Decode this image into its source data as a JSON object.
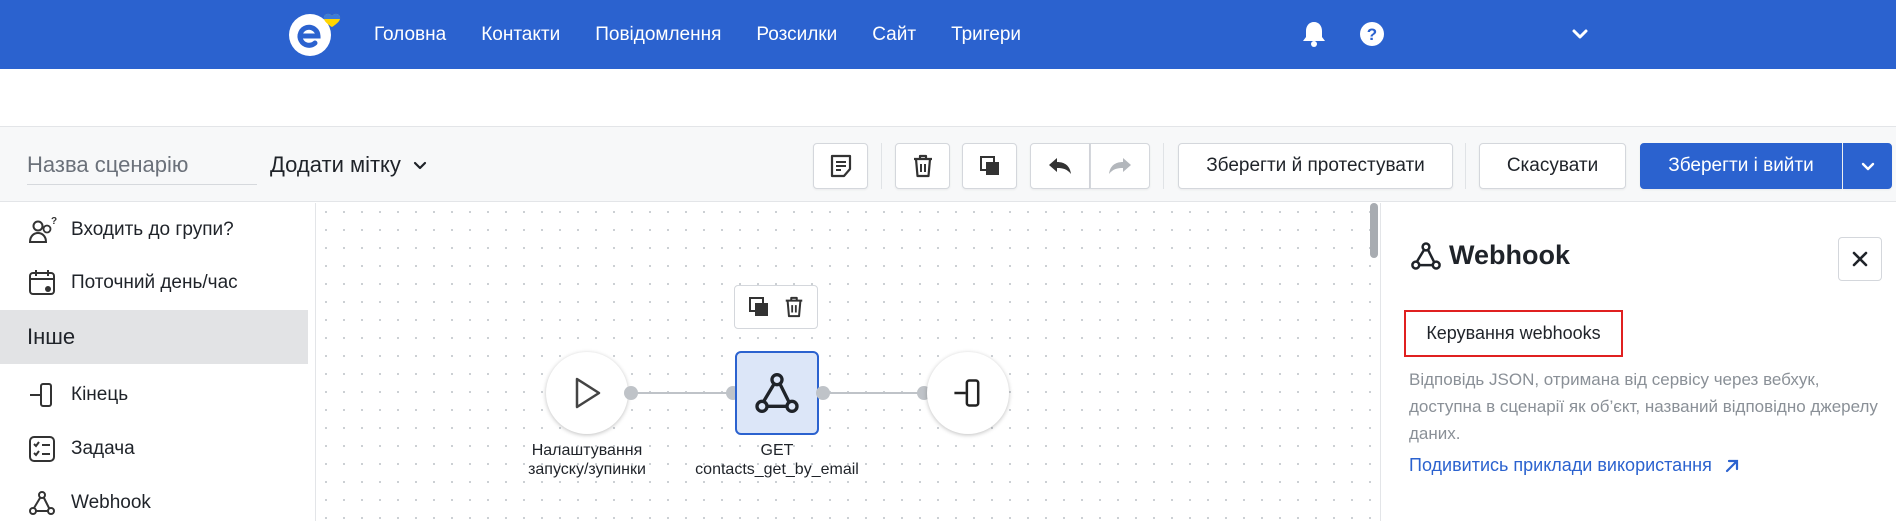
{
  "nav": {
    "items": [
      "Головна",
      "Контакти",
      "Повідомлення",
      "Розсилки",
      "Сайт",
      "Тригери"
    ]
  },
  "icons": {
    "logo": "esputnik-logo-icon",
    "bell": "bell-icon",
    "help": "help-circle-icon",
    "chevron": "chevron-down-icon"
  },
  "colors": {
    "brand": "#2b62cf",
    "highlight": "#e02020"
  },
  "toolbar": {
    "name_placeholder": "Назва сценарію",
    "tag_label": "Додати мітку",
    "save_test_label": "Зберегти й протестувати",
    "cancel_label": "Скасувати",
    "save_exit_label": "Зберегти і вийти"
  },
  "left_panel": {
    "items_top": [
      {
        "label": "Входить до групи?",
        "icon": "group-question-icon"
      },
      {
        "label": "Поточний день/час",
        "icon": "calendar-clock-icon"
      }
    ],
    "section": "Інше",
    "items_bottom": [
      {
        "label": "Кінець",
        "icon": "end-icon"
      },
      {
        "label": "Задача",
        "icon": "task-list-icon"
      },
      {
        "label": "Webhook",
        "icon": "webhook-icon"
      }
    ]
  },
  "canvas": {
    "nodes": [
      {
        "label_line1": "Налаштування",
        "label_line2": "запуску/зупинки",
        "icon": "play-icon"
      },
      {
        "label_line1": "GET",
        "label_line2": "contacts_get_by_email",
        "icon": "webhook-icon"
      },
      {
        "label_line1": "",
        "label_line2": "",
        "icon": "end-icon"
      }
    ]
  },
  "right_panel": {
    "title": "Webhook",
    "tab_label": "Керування webhooks",
    "description": "Відповідь JSON, отримана від сервісу через вебхук, доступна в сценарії як об’єкт, названий відповідно джерелу даних.",
    "link_label": "Подивитись приклади використання"
  }
}
